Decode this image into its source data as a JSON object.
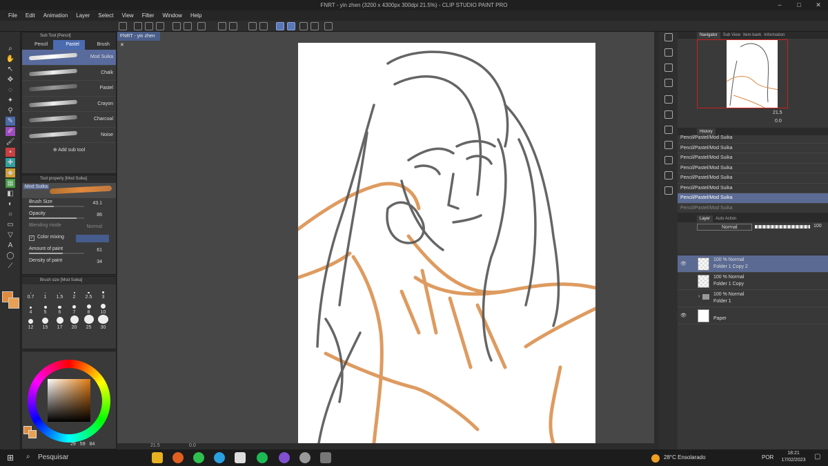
{
  "window": {
    "title": "FNRT - yin zhen (3200 x 4300px 300dpi 21.5%) - CLIP STUDIO PAINT PRO"
  },
  "menu": [
    "File",
    "Edit",
    "Animation",
    "Layer",
    "Select",
    "View",
    "Filter",
    "Window",
    "Help"
  ],
  "subtool": {
    "title": "Sub Tool [Pencil]",
    "tabs": [
      "Pencil",
      "Pastel",
      "Brush Set"
    ],
    "selected_tab": "Pastel",
    "brushes": [
      "Mod Suika",
      "Chalk",
      "Pastel",
      "Crayon",
      "Charcoal",
      "Noise"
    ],
    "selected": "Mod Suika",
    "add_label": "Add sub tool"
  },
  "toolprop": {
    "title": "Tool property [Mod Suika]",
    "name": "Mod Suika",
    "brush_size_label": "Brush Size",
    "brush_size": "43.1",
    "opacity_label": "Opacity",
    "opacity": "86",
    "blending_label": "Blending mode",
    "blending": "Normal",
    "color_mixing_label": "Color mixing",
    "amount_label": "Amount of paint",
    "amount": "61",
    "density_label": "Density of paint",
    "density": "34"
  },
  "brushsize": {
    "title": "Brush size [Mod Suika]",
    "sizes": [
      "0.7",
      "1",
      "1.5",
      "2",
      "2.5",
      "3",
      "4",
      "5",
      "6",
      "7",
      "8",
      "10",
      "12",
      "15",
      "17",
      "20",
      "25",
      "30"
    ]
  },
  "color": {
    "main": "#e08a3c",
    "sub": "#e8a052",
    "readout": [
      "29",
      "59",
      "84"
    ]
  },
  "document": {
    "tab": "FNRT - yin zhen",
    "zoom": "21.5",
    "angle": "0.0"
  },
  "navigator": {
    "tabs": [
      "Navigator",
      "Sub View",
      "Item bank",
      "Information"
    ],
    "zoom": "21.5",
    "rotate": "0.0"
  },
  "history": {
    "title": "History",
    "items": [
      "Pencil/Pastel/Mod Suika",
      "Pencil/Pastel/Mod Suika",
      "Pencil/Pastel/Mod Suika",
      "Pencil/Pastel/Mod Suika",
      "Pencil/Pastel/Mod Suika",
      "Pencil/Pastel/Mod Suika",
      "Pencil/Pastel/Mod Suika",
      "Pencil/Pastel/Mod Suika"
    ],
    "selected_index": 6
  },
  "layers": {
    "tabs": [
      "Layer",
      "Auto Action"
    ],
    "blend": "Normal",
    "opacity": "100",
    "items": [
      {
        "line1": "100 % Normal",
        "line2": "Folder 1 Copy 2"
      },
      {
        "line1": "100 % Normal",
        "line2": "Folder 1 Copy"
      },
      {
        "line1": "100 % Normal",
        "line2": "Folder 1"
      },
      {
        "line1": "",
        "line2": "Paper"
      }
    ]
  },
  "taskbar": {
    "search": "Pesquisar",
    "weather": "28°C  Ensolarado",
    "lang": "POR",
    "time": "18:21",
    "date": "17/02/2023"
  }
}
